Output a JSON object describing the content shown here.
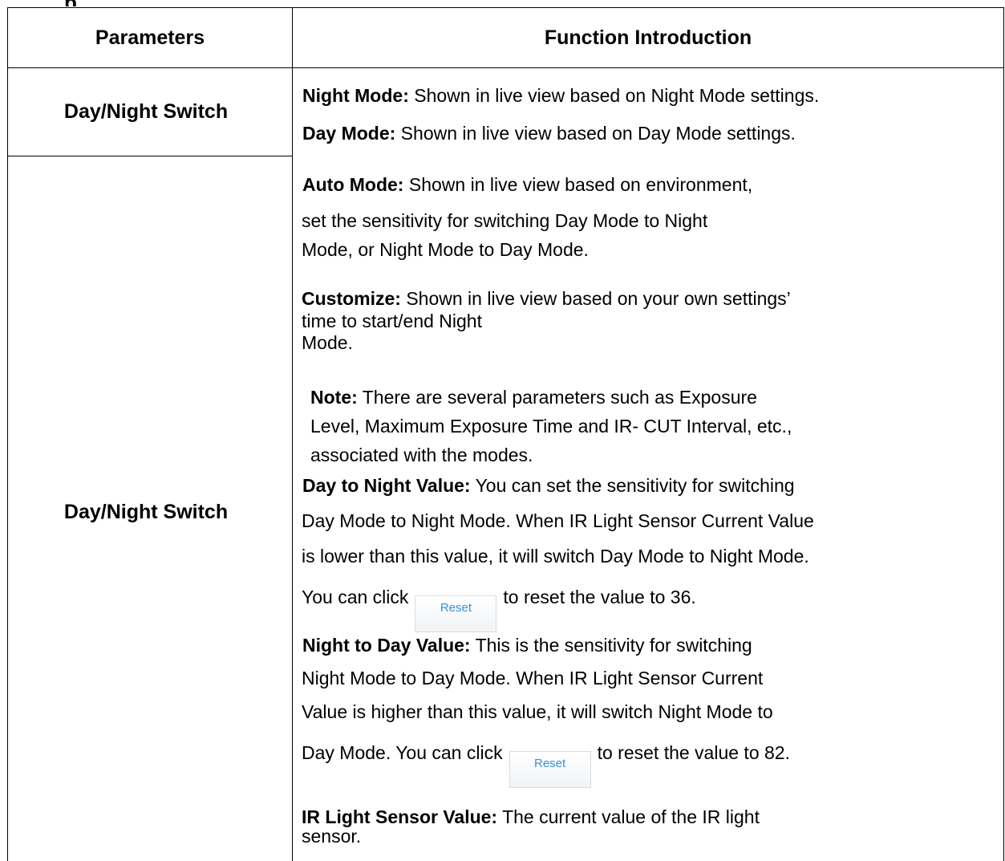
{
  "heading_fragment": "p",
  "table": {
    "headers": {
      "parameters": "Parameters",
      "function": "Function Introduction"
    },
    "rows": [
      {
        "param": "Day/Night Switch"
      },
      {
        "param": "Day/Night Switch"
      }
    ]
  },
  "content": {
    "night_mode": {
      "label": "Night Mode:",
      "text": " Shown in live view based on Night Mode settings."
    },
    "day_mode": {
      "label": "Day Mode:",
      "text": " Shown in live view based on Day Mode settings."
    },
    "auto_mode": {
      "label": "Auto Mode:",
      "line1": " Shown in live view based on environment,",
      "line2": "set the sensitivity for switching Day Mode to Night",
      "line3": "Mode, or Night Mode to Day Mode."
    },
    "customize": {
      "label": "Customize:",
      "line1": " Shown in live view based on your own settings’",
      "line2": "time to start/end Night",
      "line3": "Mode."
    },
    "note": {
      "label": "Note:",
      "line1": "  There are several parameters such as Exposure",
      "line2": "Level, Maximum Exposure Time and IR- CUT Interval, etc.,",
      "line3": "associated with the modes."
    },
    "day_to_night": {
      "label": "Day to Night Value:",
      "line1": " You can set the sensitivity for switching",
      "line2": "Day Mode to Night Mode. When IR Light Sensor Current Value",
      "line3": "is lower than this value, it will switch Day Mode to Night Mode.",
      "click_before": "You can click",
      "button": "Reset",
      "click_after": "to reset the value to 36."
    },
    "night_to_day": {
      "label": "Night to Day Value:",
      "line1": " This is the sensitivity for switching",
      "line2": "Night Mode to Day Mode. When IR Light Sensor Current",
      "line3": "Value is higher than this value, it will switch Night Mode to",
      "click_before": "Day Mode. You can click",
      "button": "Reset",
      "click_after": "to reset the value to 82."
    },
    "ir_sensor": {
      "label": "IR Light Sensor Value:",
      "line1": " The current value of the IR light",
      "line2": "sensor."
    }
  }
}
